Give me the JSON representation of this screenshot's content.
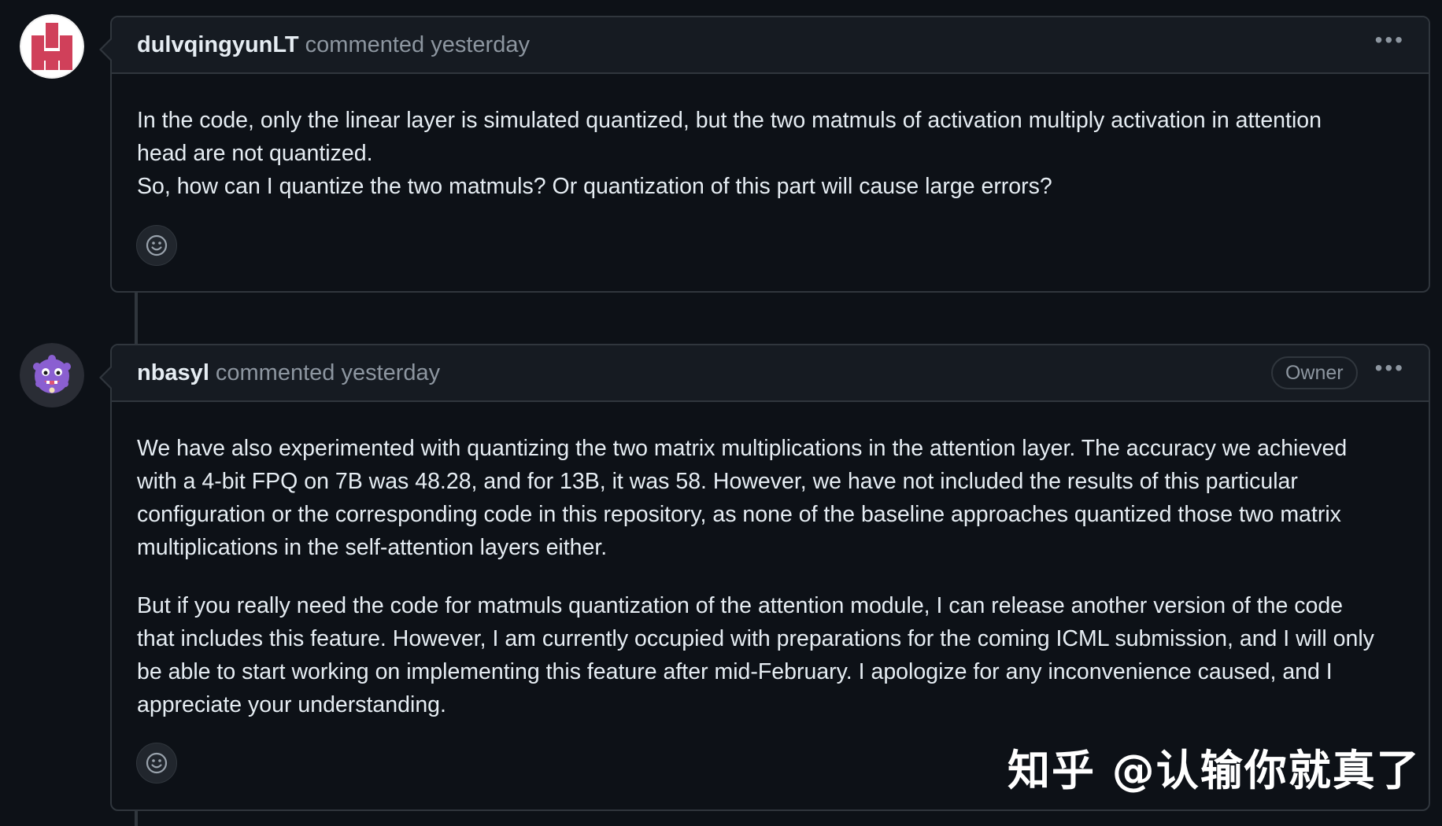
{
  "comments": [
    {
      "author": "dulvqingyunLT",
      "meta": "commented yesterday",
      "paragraphs": [
        [
          "In the code, only the linear layer is simulated quantized, but the two matmuls of activation multiply activation in attention",
          "head are not quantized.",
          "So, how can I quantize the two matmuls? Or quantization of this part will cause large errors?"
        ]
      ],
      "avatar_icon": "identicon-avatar"
    },
    {
      "author": "nbasyl",
      "meta": "commented yesterday",
      "badge": "Owner",
      "paragraphs": [
        [
          "We have also experimented with quantizing the two matrix multiplications in the attention layer. The accuracy we achieved",
          "with a 4-bit FPQ on 7B was 48.28, and for 13B, it was 58. However, we have not included the results of this particular",
          "configuration or the corresponding code in this repository, as none of the baseline approaches quantized those two matrix",
          "multiplications in the self-attention layers either."
        ],
        [
          "But if you really need the code for matmuls quantization of the attention module, I can release another version of the code",
          "that includes this feature. However, I am currently occupied with preparations for the coming ICML submission, and I will only",
          "be able to start working on implementing this feature after mid-February. I apologize for any inconvenience caused, and I",
          "appreciate your understanding."
        ]
      ],
      "avatar_icon": "purple-monster-avatar"
    }
  ],
  "icons": {
    "more": "kebab-horizontal-icon",
    "reaction": "smiley-icon"
  },
  "watermark": "知乎 @认输你就真了",
  "colors": {
    "background": "#0d1117",
    "header_bg": "#161b22",
    "border": "#30363d",
    "text": "#e6edf3",
    "muted": "#8d96a0",
    "identicon": "#d0405a"
  }
}
